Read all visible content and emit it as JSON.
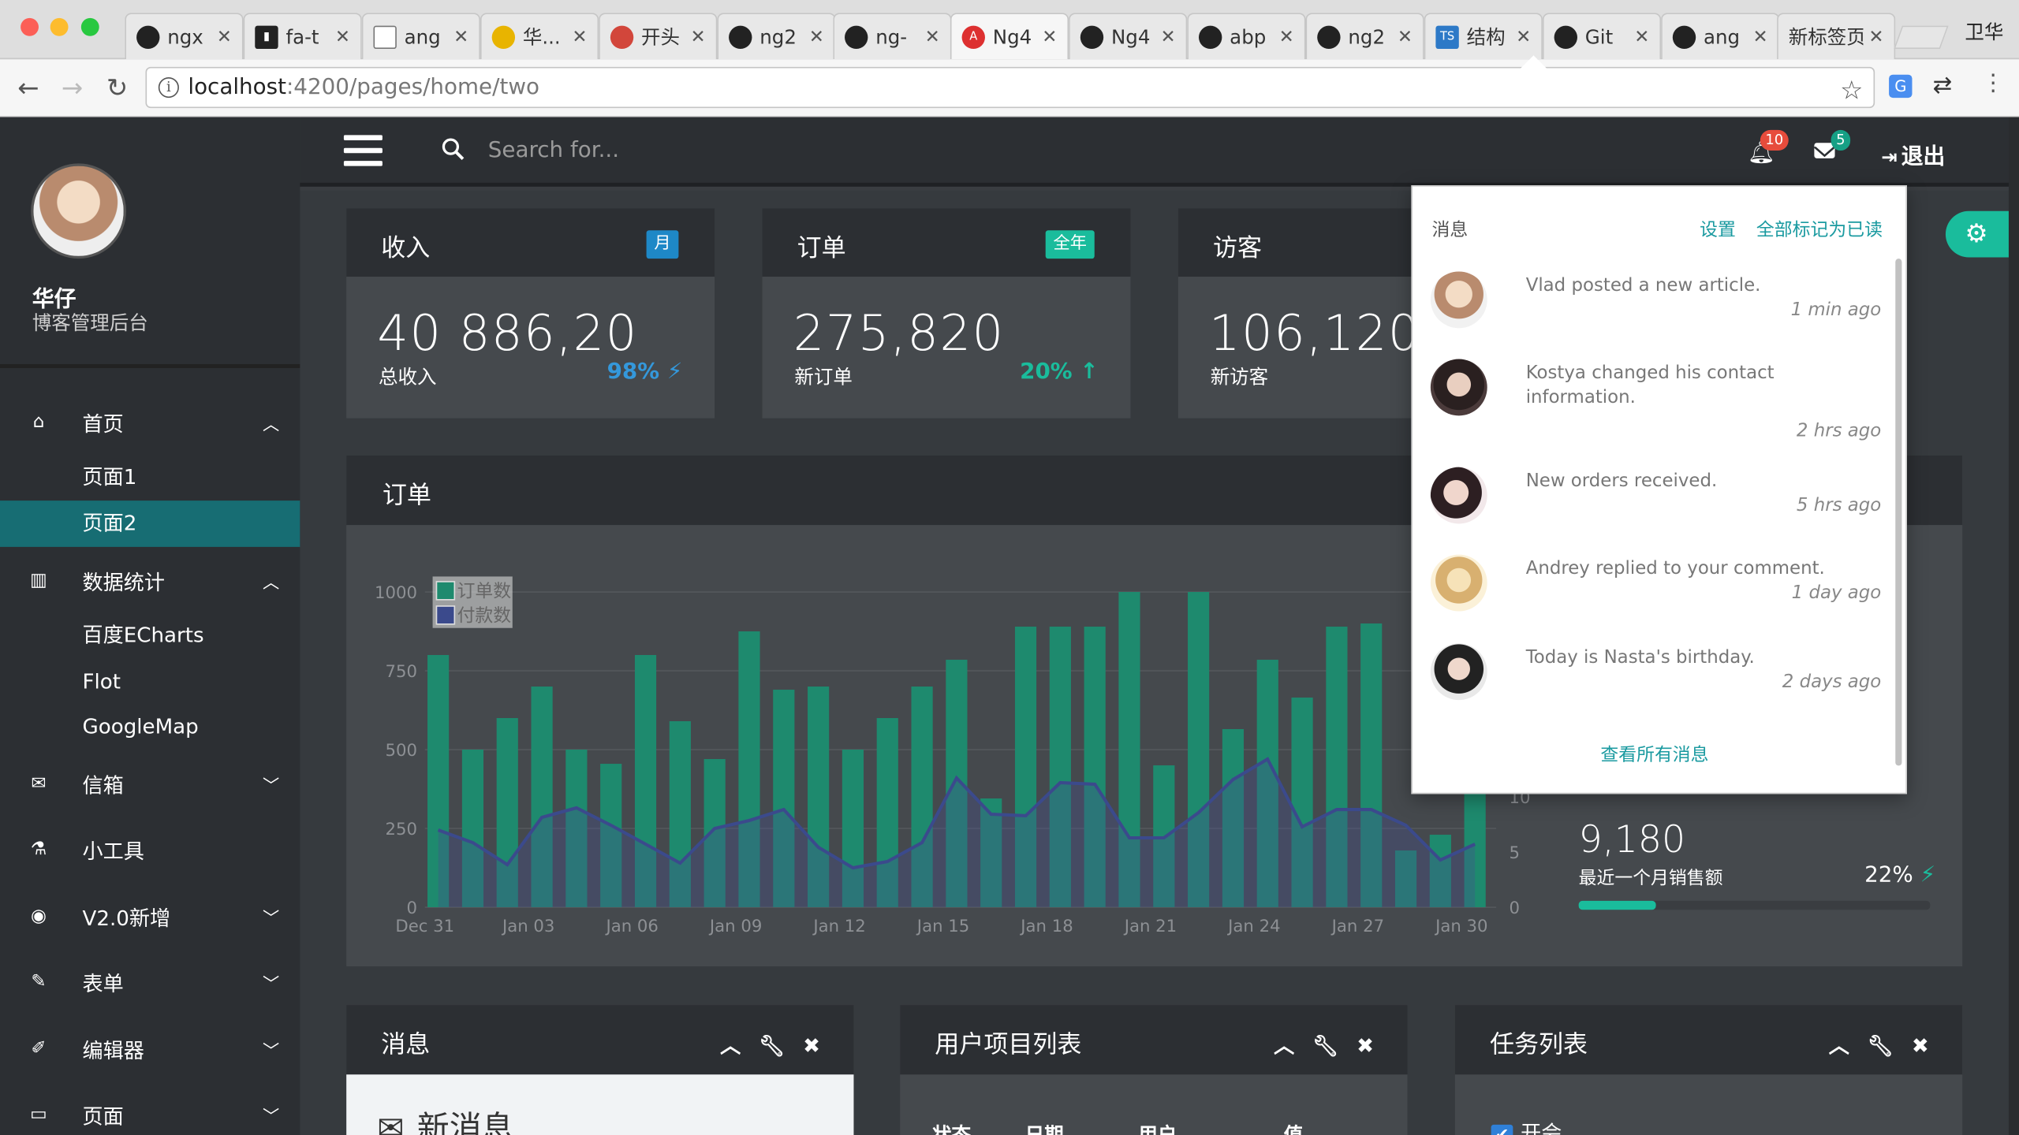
{
  "browser": {
    "tabs": [
      {
        "label": "ngx",
        "icon": "github-icon"
      },
      {
        "label": "fa-t",
        "icon": "flag-icon"
      },
      {
        "label": "ang",
        "icon": "document-icon"
      },
      {
        "label": "华...",
        "icon": "leaf-icon"
      },
      {
        "label": "开头",
        "icon": "shield-icon"
      },
      {
        "label": "ng2",
        "icon": "github-icon"
      },
      {
        "label": "ng-",
        "icon": "github-icon"
      },
      {
        "label": "Ng4",
        "icon": "angular-icon"
      },
      {
        "label": "Ng4",
        "icon": "github-icon"
      },
      {
        "label": "abp",
        "icon": "github-icon"
      },
      {
        "label": "ng2",
        "icon": "github-icon"
      },
      {
        "label": "结构",
        "icon": "typescript-icon"
      },
      {
        "label": "Git",
        "icon": "github-icon"
      },
      {
        "label": "ang",
        "icon": "github-icon"
      },
      {
        "label": "新标签页",
        "icon": "none"
      }
    ],
    "profile_name": "卫华",
    "url_host": "localhost",
    "url_path": ":4200/pages/home/two"
  },
  "sidebar": {
    "user_name": "华仔",
    "user_subtitle": "博客管理后台",
    "menu": [
      {
        "label": "首页",
        "icon": "home-icon",
        "caret": "up"
      },
      {
        "label": "页面1",
        "sub": true
      },
      {
        "label": "页面2",
        "sub": true,
        "active": true
      },
      {
        "label": "数据统计",
        "icon": "bar-chart-icon",
        "caret": "up"
      },
      {
        "label": "百度ECharts",
        "sub": true
      },
      {
        "label": "Flot",
        "sub": true
      },
      {
        "label": "GoogleMap",
        "sub": true
      },
      {
        "label": "信箱",
        "icon": "envelope-icon",
        "caret": "down"
      },
      {
        "label": "小工具",
        "icon": "flask-icon"
      },
      {
        "label": "V2.0新增",
        "icon": "globe-icon",
        "caret": "down"
      },
      {
        "label": "表单",
        "icon": "edit-icon",
        "caret": "down"
      },
      {
        "label": "编辑器",
        "icon": "pencil-icon",
        "caret": "down"
      },
      {
        "label": "页面",
        "icon": "desktop-icon",
        "caret": "down"
      }
    ]
  },
  "topbar": {
    "search_placeholder": "Search for...",
    "notifications_count": "10",
    "messages_count": "5",
    "logout_label": "退出"
  },
  "stats": [
    {
      "title": "收入",
      "tag": "月",
      "tag_color": "#1e88c7",
      "value": "40 886,20",
      "label": "总收入",
      "pct": "98%",
      "pct_color": "#3498db",
      "pct_icon": "⚡"
    },
    {
      "title": "订单",
      "tag": "全年",
      "tag_color": "#1abc9c",
      "value": "275,820",
      "label": "新订单",
      "pct": "20%",
      "pct_color": "#1abc9c",
      "pct_icon": "↑"
    },
    {
      "title": "访客",
      "tag": "",
      "tag_color": "#e74c3c",
      "value": "106,120",
      "label": "新访客",
      "pct": "",
      "pct_color": "#e74c3c",
      "pct_icon": ""
    }
  ],
  "chart_panel": {
    "title": "订单",
    "monthly_value": "9,180",
    "monthly_label": "最近一个月销售额",
    "monthly_pct": "22%",
    "monthly_progress": 0.22
  },
  "chart_data": {
    "type": "bar",
    "categories": [
      "Dec 31",
      "Jan 01",
      "Jan 02",
      "Jan 03",
      "Jan 04",
      "Jan 05",
      "Jan 06",
      "Jan 07",
      "Jan 08",
      "Jan 09",
      "Jan 10",
      "Jan 11",
      "Jan 12",
      "Jan 13",
      "Jan 14",
      "Jan 15",
      "Jan 16",
      "Jan 17",
      "Jan 18",
      "Jan 19",
      "Jan 20",
      "Jan 21",
      "Jan 22",
      "Jan 23",
      "Jan 24",
      "Jan 25",
      "Jan 26",
      "Jan 27",
      "Jan 28",
      "Jan 29",
      "Jan 30"
    ],
    "x_tick_labels": [
      "Dec 31",
      "Jan 03",
      "Jan 06",
      "Jan 09",
      "Jan 12",
      "Jan 15",
      "Jan 18",
      "Jan 21",
      "Jan 24",
      "Jan 27",
      "Jan 30"
    ],
    "y_ticks": [
      0,
      250,
      500,
      750,
      1000
    ],
    "y2_ticks": [
      "0",
      "5",
      "10"
    ],
    "ylim": [
      0,
      1000
    ],
    "series": [
      {
        "name": "订单数",
        "color": "#1e8a6e",
        "values": [
          800,
          500,
          600,
          700,
          500,
          455,
          800,
          590,
          470,
          875,
          690,
          700,
          500,
          600,
          700,
          785,
          345,
          890,
          890,
          890,
          1000,
          450,
          1000,
          565,
          785,
          665,
          890,
          900,
          180,
          230,
          400
        ]
      },
      {
        "name": "付款数",
        "color": "#3b4a8c",
        "values": [
          245,
          205,
          135,
          285,
          315,
          260,
          200,
          140,
          250,
          275,
          310,
          190,
          125,
          145,
          205,
          410,
          295,
          290,
          395,
          390,
          220,
          220,
          300,
          405,
          470,
          255,
          310,
          310,
          260,
          150,
          200
        ]
      }
    ]
  },
  "bottom_panels": [
    {
      "title": "消息",
      "first_line": "新消息"
    },
    {
      "title": "用户项目列表",
      "headers": [
        "状态",
        "日期",
        "用户",
        "值"
      ]
    },
    {
      "title": "任务列表",
      "first_task": "开会"
    }
  ],
  "dropdown": {
    "title": "消息",
    "settings": "设置",
    "mark_all": "全部标记为已读",
    "items": [
      {
        "text": "Vlad posted a new article.",
        "time": "1 min ago"
      },
      {
        "text": "Kostya changed his contact information.",
        "time": "2 hrs ago"
      },
      {
        "text": "New orders received.",
        "time": "5 hrs ago"
      },
      {
        "text": "Andrey replied to your comment.",
        "time": "1 day ago"
      },
      {
        "text": "Today is Nasta's birthday.",
        "time": "2 days ago"
      }
    ],
    "footer": "查看所有消息"
  }
}
